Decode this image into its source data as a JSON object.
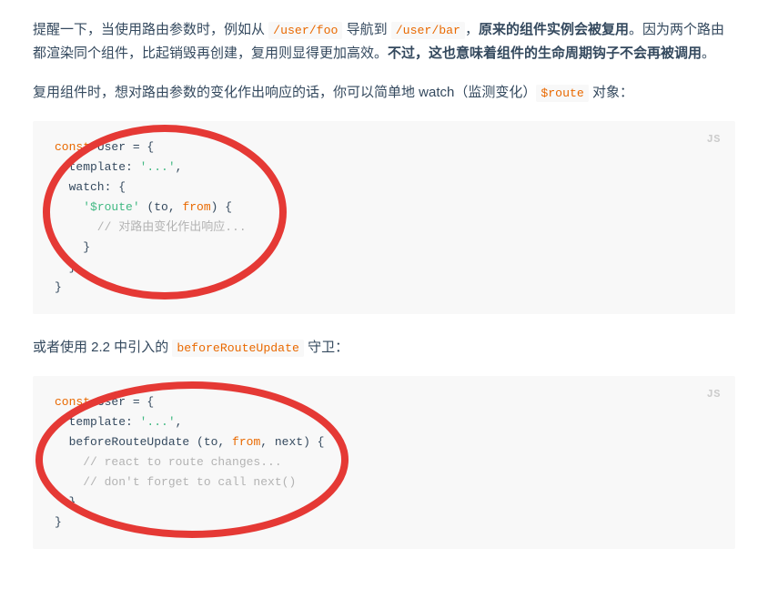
{
  "para1": {
    "t1": "提醒一下，当使用路由参数时，例如从 ",
    "c1": "/user/foo",
    "t2": " 导航到 ",
    "c2": "/user/bar",
    "t3": "，",
    "bold1": "原来的组件实例会被复用",
    "t4": "。因为两个路由都渲染同个组件，比起销毁再创建，复用则显得更加高效。",
    "bold2": "不过，这也意味着组件的生命周期钩子不会再被调用",
    "t5": "。"
  },
  "para2": {
    "t1": "复用组件时，想对路由参数的变化作出响应的话，你可以简单地 watch（监测变化）",
    "c1": "$route",
    "t2": " 对象："
  },
  "code1": {
    "lang": "JS",
    "kw_const": "const",
    "l1_rest": " User = {",
    "l2_a": "  template: ",
    "l2_str": "'...'",
    "l2_b": ",",
    "l3": "  watch: {",
    "l4_a": "    ",
    "l4_str": "'$route'",
    "l4_b": " (to, ",
    "l4_kw": "from",
    "l4_c": ") {",
    "l5_cmt": "      // 对路由变化作出响应...",
    "l6": "    }",
    "l7": "  }",
    "l8": "}"
  },
  "para3": {
    "t1": "或者使用 2.2 中引入的 ",
    "c1": "beforeRouteUpdate",
    "t2": " 守卫："
  },
  "code2": {
    "lang": "JS",
    "kw_const": "const",
    "l1_rest": " User = {",
    "l2_a": "  template: ",
    "l2_str": "'...'",
    "l2_b": ",",
    "l3_a": "  beforeRouteUpdate (to, ",
    "l3_kw": "from",
    "l3_b": ", next) {",
    "l4_cmt": "    // react to route changes...",
    "l5_cmt": "    // don't forget to call next()",
    "l6": "  }",
    "l7": "}"
  },
  "annot_color": "#e53935"
}
